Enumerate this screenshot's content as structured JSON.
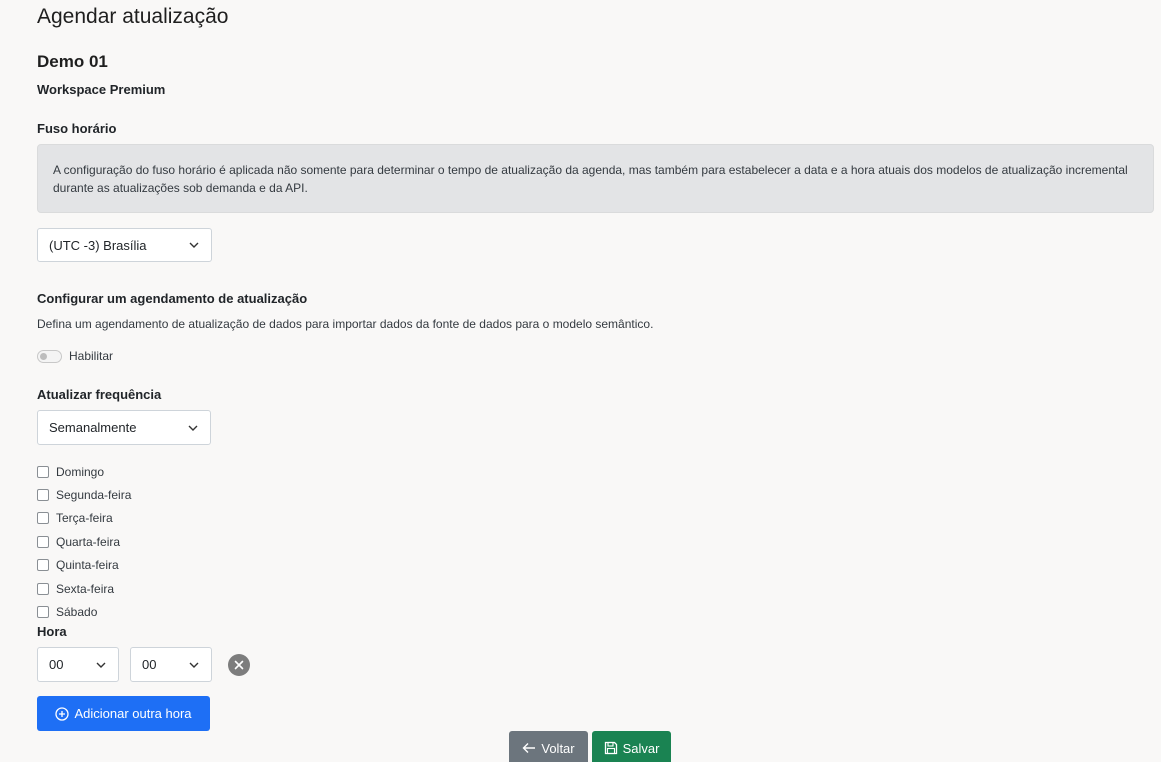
{
  "page": {
    "title": "Agendar atualização",
    "report_name": "Demo 01",
    "workspace": "Workspace Premium"
  },
  "timezone": {
    "label": "Fuso horário",
    "info": "A configuração do fuso horário é aplicada não somente para determinar o tempo de atualização da agenda, mas também para estabelecer a data e a hora atuais dos modelos de atualização incremental durante as atualizações sob demanda e da API.",
    "selected": "(UTC -3) Brasília"
  },
  "schedule": {
    "heading": "Configurar um agendamento de atualização",
    "description": "Defina um agendamento de atualização de dados para importar dados da fonte de dados para o modelo semântico.",
    "enable_label": "Habilitar",
    "enabled": false
  },
  "frequency": {
    "label": "Atualizar frequência",
    "selected": "Semanalmente"
  },
  "days": [
    {
      "label": "Domingo",
      "checked": false
    },
    {
      "label": "Segunda-feira",
      "checked": false
    },
    {
      "label": "Terça-feira",
      "checked": false
    },
    {
      "label": "Quarta-feira",
      "checked": false
    },
    {
      "label": "Quinta-feira",
      "checked": false
    },
    {
      "label": "Sexta-feira",
      "checked": false
    },
    {
      "label": "Sábado",
      "checked": false
    }
  ],
  "time": {
    "label": "Hora",
    "hour": "00",
    "minute": "00",
    "add_button": "Adicionar outra hora"
  },
  "footer": {
    "back_button": "Voltar",
    "save_button": "Salvar"
  },
  "colors": {
    "primary": "#1e6ff5",
    "secondary": "#6c757d",
    "success": "#1a8352",
    "info_bg": "#e3e4e6",
    "page_bg": "#f9f8f7"
  },
  "icons": {
    "dropdown": "chevron-down-icon",
    "clear_time": "close-circle-icon",
    "add": "plus-circle-icon",
    "back": "arrow-left-icon",
    "save": "floppy-disk-icon"
  }
}
